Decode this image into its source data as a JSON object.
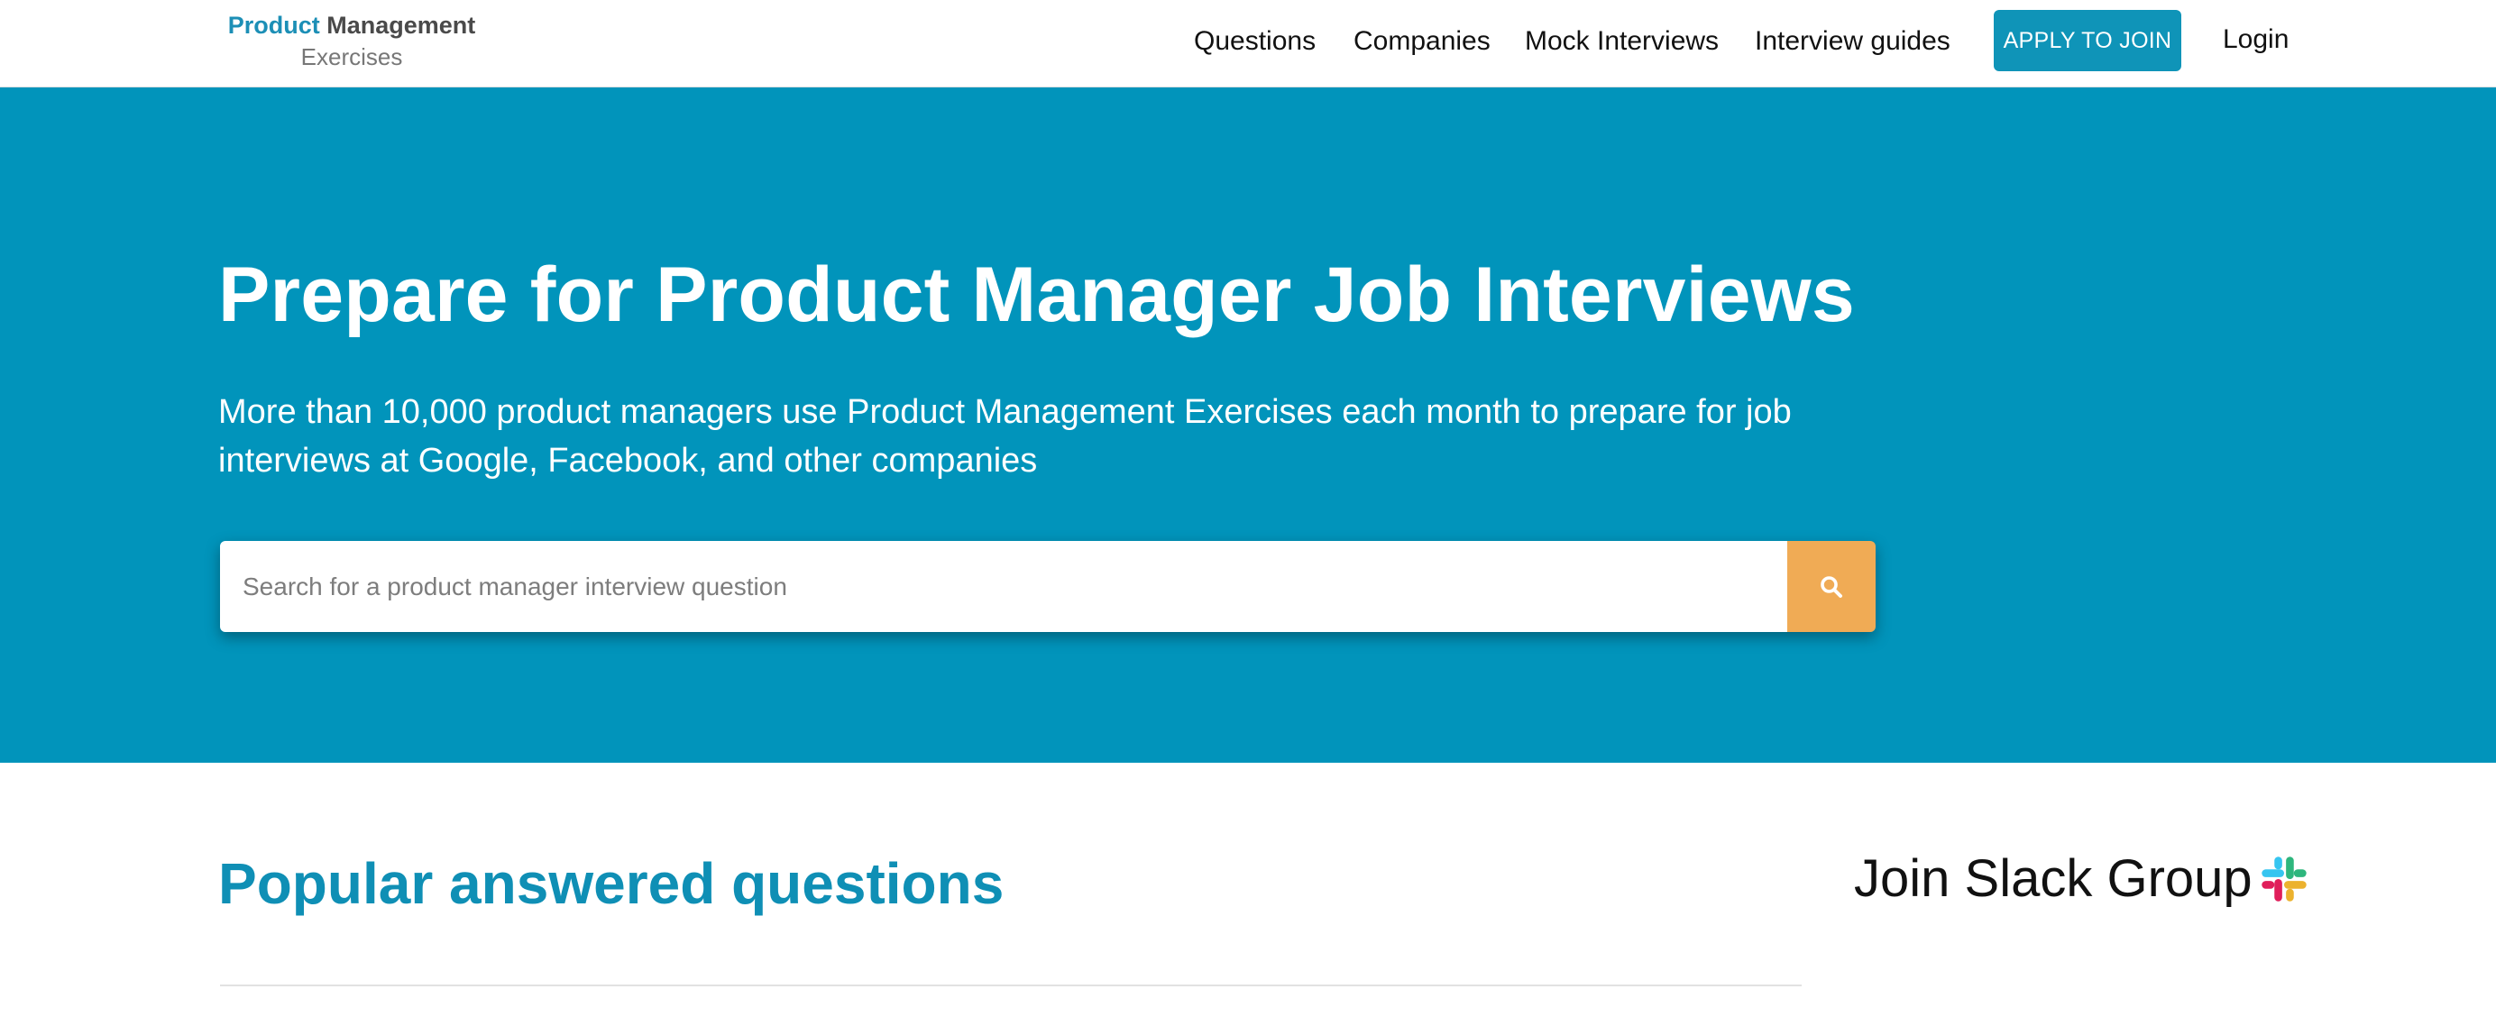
{
  "nav": {
    "logo_primary": "Product",
    "logo_secondary": "Management",
    "logo_sub": "Exercises",
    "links": [
      "Questions",
      "Companies",
      "Mock Interviews",
      "Interview guides"
    ],
    "apply_label": "APPLY TO JOIN",
    "login_label": "Login"
  },
  "hero": {
    "title": "Prepare for Product Manager Job Interviews",
    "subtitle": "More than 10,000 product managers use Product Management Exercises each month to prepare for job interviews at Google, Facebook, and other companies",
    "search_placeholder": "Search for a product manager interview question",
    "search_icon": "search-icon"
  },
  "main": {
    "popular_title": "Popular answered questions"
  },
  "sidebar": {
    "slack_label": "Join Slack Group",
    "slack_icon": "slack-icon"
  },
  "colors": {
    "brand_blue": "#0194bb",
    "button_blue": "#0f94b8",
    "search_orange": "#f0ab55",
    "heading_blue": "#0f8fb5"
  }
}
